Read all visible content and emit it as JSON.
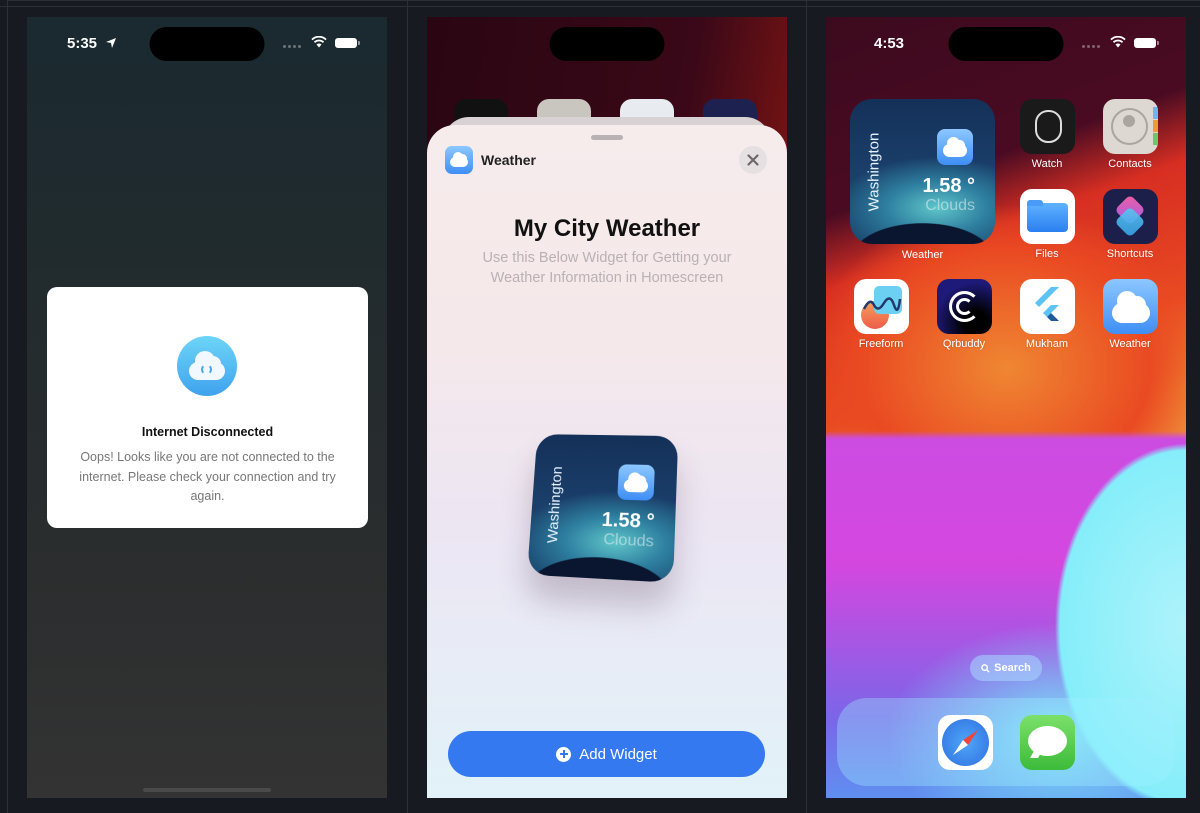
{
  "panels": [
    {
      "status": {
        "time": "5:35",
        "location_active": true
      },
      "dialog": {
        "icon": "cloud-sync-icon",
        "title": "Internet Disconnected",
        "message": "Oops! Looks like you are not connected to the internet. Please check your connection and try again."
      }
    },
    {
      "sheet": {
        "app_name": "Weather",
        "title": "My City Weather",
        "subtitle": "Use this Below Widget for Getting your Weather Information in Homescreen",
        "widget": {
          "city": "Washington",
          "temperature": "1.58 °",
          "condition": "Clouds"
        },
        "add_button": "Add Widget"
      }
    },
    {
      "status": {
        "time": "4:53"
      },
      "widget": {
        "city": "Washington",
        "temperature": "1.58 °",
        "condition": "Clouds",
        "label": "Weather"
      },
      "apps": [
        {
          "label": "Watch",
          "icon": "watch-icon"
        },
        {
          "label": "Contacts",
          "icon": "contacts-icon"
        },
        {
          "label": "Files",
          "icon": "files-icon"
        },
        {
          "label": "Shortcuts",
          "icon": "shortcuts-icon"
        },
        {
          "label": "Freeform",
          "icon": "freeform-icon"
        },
        {
          "label": "Qrbuddy",
          "icon": "qrbuddy-icon"
        },
        {
          "label": "Mukham",
          "icon": "flutter-icon"
        },
        {
          "label": "Weather",
          "icon": "weather-icon"
        }
      ],
      "search_label": "Search",
      "dock": [
        {
          "app": "Safari",
          "icon": "safari-icon"
        },
        {
          "app": "Messages",
          "icon": "messages-icon"
        }
      ]
    }
  ]
}
